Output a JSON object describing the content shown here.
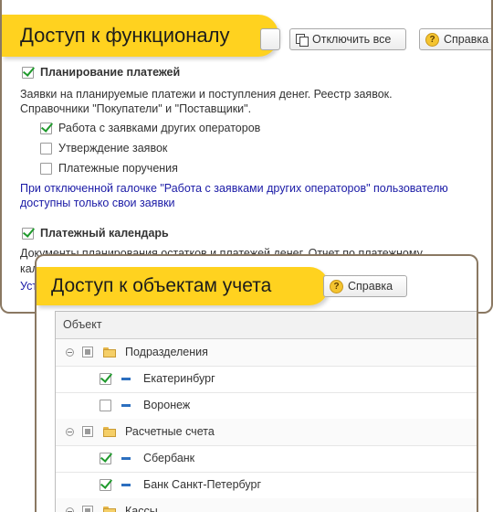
{
  "win1": {
    "title": "Доступ к функционалу",
    "btn_partial": "",
    "btn_disable_all": "Отключить все",
    "btn_help": "Справка",
    "planning": {
      "label": "Планирование платежей",
      "desc1": "Заявки на планируемые платежи и поступления денег. Реестр заявок.",
      "desc2": "Справочники \"Покупатели\" и \"Поставщики\".",
      "options": [
        {
          "label": "Работа с заявками других операторов",
          "checked": true
        },
        {
          "label": "Утверждение заявок",
          "checked": false
        },
        {
          "label": "Платежные поручения",
          "checked": false
        }
      ],
      "note1": "При отключенной галочке \"Работа с заявками других операторов\" пользователю",
      "note2": "доступны только свои заявки"
    },
    "calendar": {
      "label": "Платежный календарь",
      "desc1": "Документы планирования остатков и платежей денег. Отчет по платежному",
      "desc2": "кал",
      "link": "Уст"
    }
  },
  "win2": {
    "title": "Доступ к объектам учета",
    "btn_help": "Справка",
    "column_header": "Объект",
    "rows": [
      {
        "type": "group",
        "label": "Подразделения"
      },
      {
        "type": "item",
        "label": "Екатеринбург",
        "checked": true
      },
      {
        "type": "item",
        "label": "Воронеж",
        "checked": false
      },
      {
        "type": "group",
        "label": "Расчетные счета"
      },
      {
        "type": "item",
        "label": "Сбербанк",
        "checked": true
      },
      {
        "type": "item",
        "label": "Банк Санкт-Петербург",
        "checked": true
      },
      {
        "type": "group",
        "label": "Кассы"
      }
    ]
  },
  "colors": {
    "banner": "#ffd21f",
    "check": "#1f9a2c",
    "note": "#1a1aa6",
    "frame": "#8a7862"
  },
  "icons": [
    "copy-icon",
    "help-icon",
    "folder-icon",
    "item-dash-icon",
    "collapse-icon"
  ]
}
